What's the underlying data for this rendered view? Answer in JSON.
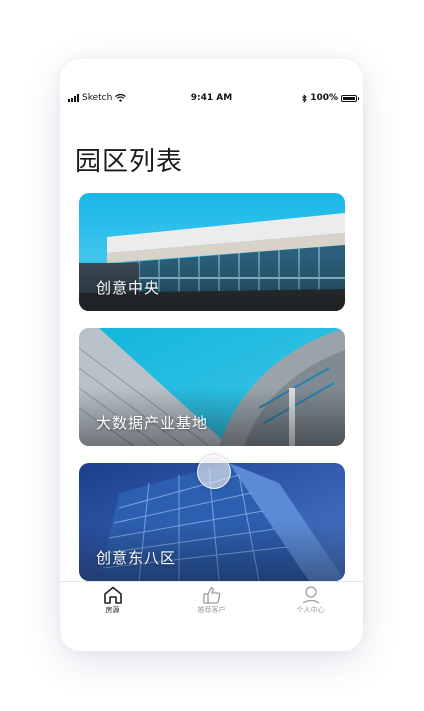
{
  "status_bar": {
    "carrier": "Sketch",
    "time": "9:41 AM",
    "battery": "100%"
  },
  "page": {
    "title": "园区列表"
  },
  "parks": [
    {
      "name": "创意中央"
    },
    {
      "name": "大数据产业基地"
    },
    {
      "name": "创意东八区"
    }
  ],
  "tab_bar": {
    "tabs": [
      {
        "label": "房源",
        "icon": "home-icon",
        "active": true
      },
      {
        "label": "推荐客户",
        "icon": "thumbs-up-icon",
        "active": false
      },
      {
        "label": "个人中心",
        "icon": "user-icon",
        "active": false
      }
    ]
  },
  "colors": {
    "accent": "#1a1a1a",
    "inactive_tab": "#9a9a9a"
  }
}
